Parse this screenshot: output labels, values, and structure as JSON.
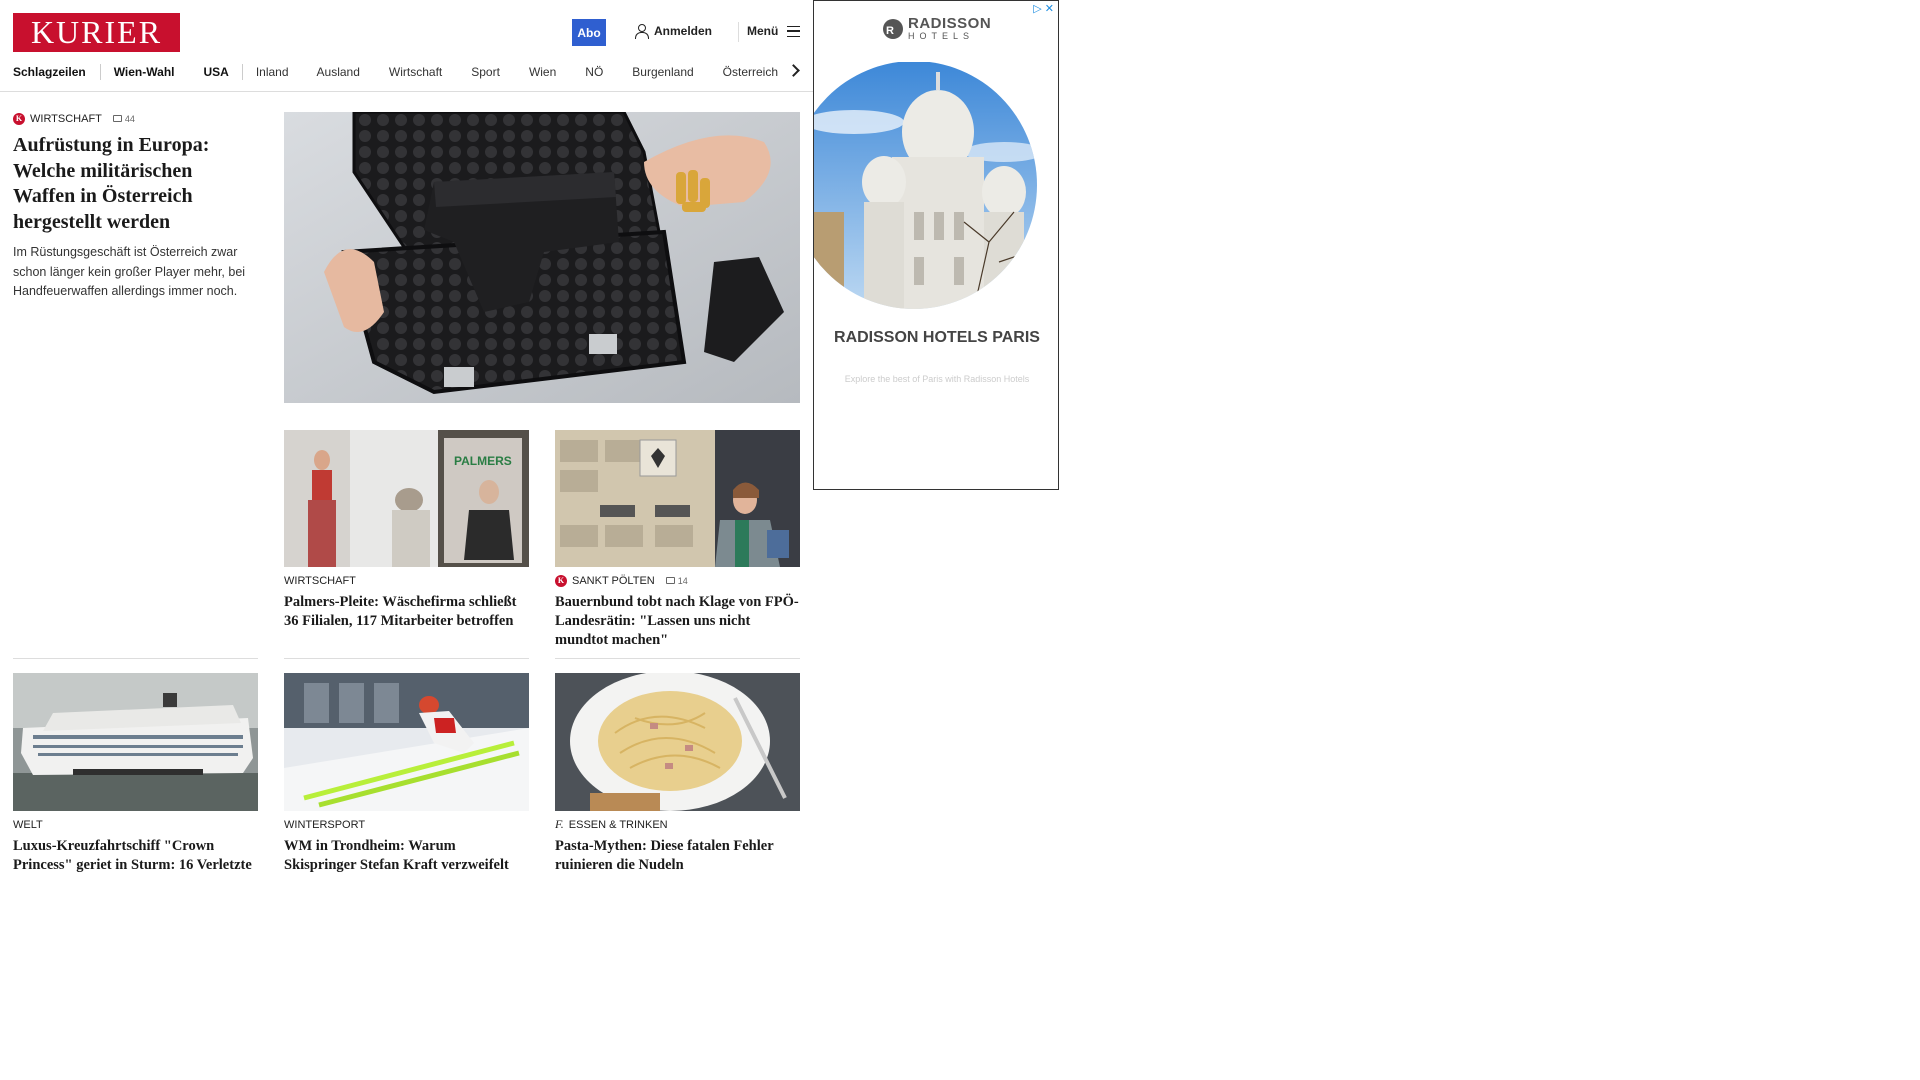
{
  "header": {
    "logo": "KURIER",
    "abo_label": "Abo",
    "login_label": "Anmelden",
    "menu_label": "Menü"
  },
  "nav": {
    "items": [
      "Schlagzeilen",
      "Wien-Wahl",
      "USA",
      "Inland",
      "Ausland",
      "Wirtschaft",
      "Sport",
      "Wien",
      "NÖ",
      "Burgenland",
      "Österreich"
    ]
  },
  "lead": {
    "rubric": "WIRTSCHAFT",
    "comments": "44",
    "headline": "Aufrüstung in Europa: Welche militärischen Waffen in Österreich hergestellt werden",
    "teaser": "Im Rüstungsgeschäft ist Österreich zwar schon länger kein großer Player mehr, bei Handfeuerwaffen allerdings immer noch."
  },
  "cards": [
    {
      "rubric": "WIRTSCHAFT",
      "headline": "Palmers-Pleite: Wäschefirma schließt 36 Filialen, 117 Mitarbeiter betroffen"
    },
    {
      "rubric": "SANKT PÖLTEN",
      "comments": "14",
      "headline": "Bauernbund tobt nach Klage von FPÖ-Landesrätin: \"Lassen uns nicht mundtot machen\""
    },
    {
      "rubric": "WELT",
      "headline": "Luxus-Kreuzfahrtschiff \"Crown Princess\" geriet in Sturm: 16 Verletzte"
    },
    {
      "rubric": "WINTERSPORT",
      "headline": "WM in Trondheim: Warum Skispringer Stefan Kraft verzweifelt"
    },
    {
      "rubric": "ESSEN & TRINKEN",
      "headline": "Pasta-Mythen: Diese fatalen Fehler ruinieren die Nudeln"
    }
  ],
  "ad": {
    "close_label": "▷ ✕",
    "brand": "RADISSON",
    "brand_sub": "HOTELS",
    "title": "RADISSON HOTELS PARIS",
    "description": "Explore the best of Paris with Radisson Hotels"
  },
  "colors": {
    "brand_red": "#c8102e",
    "abo_blue": "#2f5fd0"
  },
  "icons": [
    "user-icon",
    "hamburger-icon",
    "chevron-right-icon",
    "comment-icon",
    "kurier-k-icon"
  ]
}
